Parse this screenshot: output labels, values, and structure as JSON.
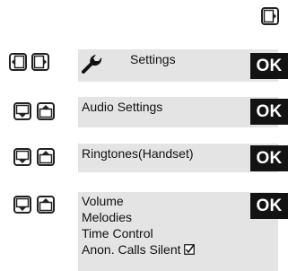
{
  "screen": {
    "rows": [
      {
        "panel_label": "Settings",
        "panel_icon": "wrench-icon",
        "ok_label": "OK",
        "keys": [
          "nav-left-key-icon",
          "nav-right-key-icon"
        ]
      },
      {
        "panel_label": "Audio Settings",
        "ok_label": "OK",
        "keys": [
          "nav-down-key-icon",
          "nav-up-key-icon"
        ]
      },
      {
        "panel_label": "Ringtones(Handset)",
        "ok_label": "OK",
        "keys": [
          "nav-down-key-icon",
          "nav-up-key-icon"
        ]
      },
      {
        "panel_items": [
          "Volume",
          "Melodies",
          "Time Control",
          "Anon. Calls Silent"
        ],
        "checked_item": "Anon. Calls Silent",
        "checked_icon": "checkbox-checked-icon",
        "ok_label": "OK",
        "keys": [
          "nav-down-key-icon",
          "nav-up-key-icon"
        ]
      }
    ],
    "top_key_icon": "nav-right-key-icon",
    "colors": {
      "panel_bg": "#e4e4e4",
      "ok_bg": "#131313",
      "ok_text": "#ffffff"
    }
  }
}
